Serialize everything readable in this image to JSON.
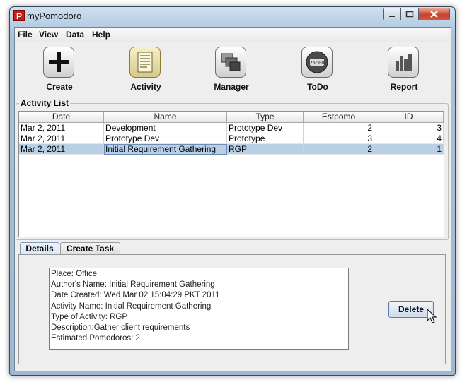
{
  "window": {
    "title": "myPomodoro",
    "app_icon_letter": "P"
  },
  "menu": {
    "items": [
      "File",
      "View",
      "Data",
      "Help"
    ]
  },
  "toolbar": {
    "buttons": [
      {
        "label": "Create",
        "icon": "plus-icon"
      },
      {
        "label": "Activity",
        "icon": "document-list-icon",
        "selected": true
      },
      {
        "label": "Manager",
        "icon": "stacked-windows-icon"
      },
      {
        "label": "ToDo",
        "icon": "clock-icon",
        "icon_text": "25:00"
      },
      {
        "label": "Report",
        "icon": "bar-chart-icon"
      }
    ]
  },
  "activity_list": {
    "title": "Activity List",
    "columns": [
      "Date",
      "Name",
      "Type",
      "Estpomo",
      "ID"
    ],
    "rows": [
      [
        "Mar 2, 2011",
        "Development",
        "Prototype Dev",
        "2",
        "3"
      ],
      [
        "Mar 2, 2011",
        "Prototype Dev",
        "Prototype",
        "3",
        "4"
      ],
      [
        "Mar 2, 2011",
        "Initial Requirement Gathering",
        "RGP",
        "2",
        "1"
      ]
    ],
    "selected_row": 2
  },
  "tabs": [
    "Details",
    "Create Task"
  ],
  "active_tab": "Details",
  "details": {
    "lines": [
      "Place: Office",
      "Author's Name: Initial Requirement Gathering",
      "Date Created: Wed Mar 02 15:04:29 PKT 2011",
      "Activity Name: Initial Requirement Gathering",
      "Type of Activity: RGP",
      "Description:Gather client requirements",
      "Estimated Pomodoros: 2"
    ]
  },
  "delete_button": {
    "label": "Delete"
  },
  "colors": {
    "selection": "#b8cfe5",
    "close_button": "#c6442a",
    "title_bar": "#a9c3dc"
  }
}
